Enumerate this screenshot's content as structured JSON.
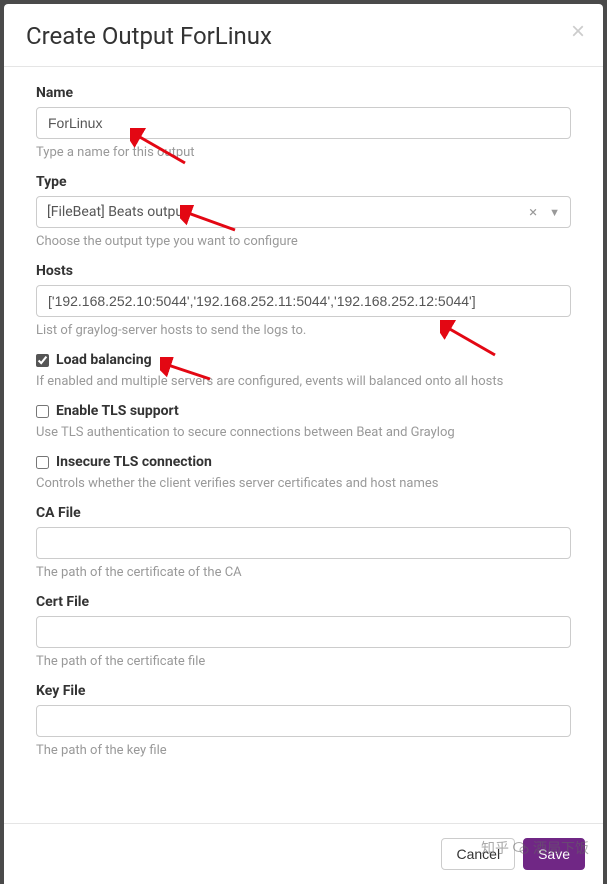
{
  "modal": {
    "title": "Create Output ForLinux",
    "close_label": "×"
  },
  "fields": {
    "name": {
      "label": "Name",
      "value": "ForLinux",
      "help": "Type a name for this output"
    },
    "type": {
      "label": "Type",
      "value": "[FileBeat] Beats output",
      "help": "Choose the output type you want to configure"
    },
    "hosts": {
      "label": "Hosts",
      "value": "['192.168.252.10:5044','192.168.252.11:5044','192.168.252.12:5044']",
      "help": "List of graylog-server hosts to send the logs to."
    },
    "load_balancing": {
      "label": "Load balancing",
      "checked": true,
      "help": "If enabled and multiple servers are configured, events will balanced onto all hosts"
    },
    "enable_tls": {
      "label": "Enable TLS support",
      "checked": false,
      "help": "Use TLS authentication to secure connections between Beat and Graylog"
    },
    "insecure_tls": {
      "label": "Insecure TLS connection",
      "checked": false,
      "help": "Controls whether the client verifies server certificates and host names"
    },
    "ca_file": {
      "label": "CA File",
      "value": "",
      "help": "The path of the certificate of the CA"
    },
    "cert_file": {
      "label": "Cert File",
      "value": "",
      "help": "The path of the certificate file"
    },
    "key_file": {
      "label": "Key File",
      "value": "",
      "help": "The path of the key file"
    }
  },
  "footer": {
    "cancel": "Cancel",
    "save": "Save"
  },
  "watermark": {
    "brand": "知乎",
    "user": "酒局下饭"
  }
}
